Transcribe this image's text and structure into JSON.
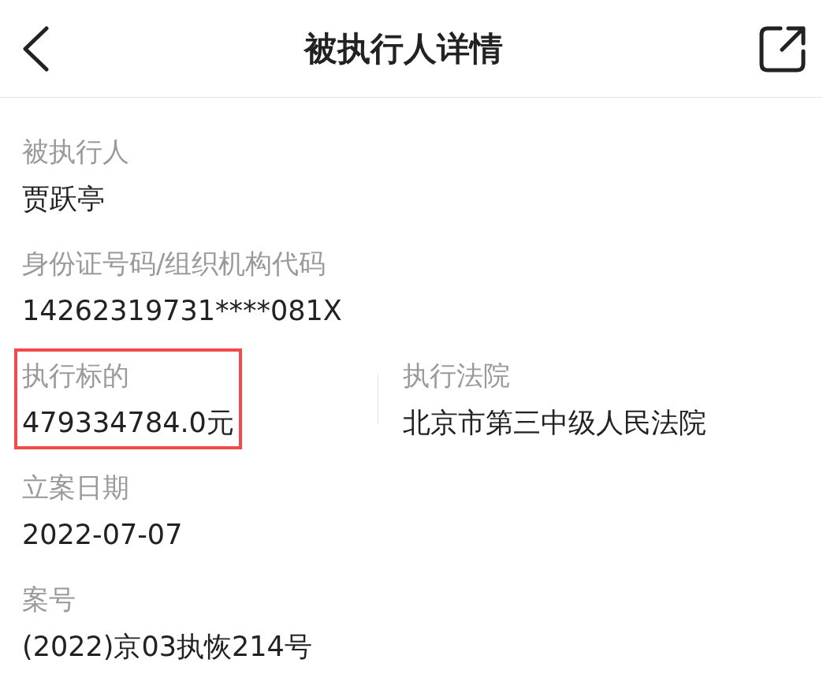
{
  "header": {
    "title": "被执行人详情"
  },
  "rows": [
    {
      "fields": [
        {
          "label": "被执行人",
          "value": "贾跃亭",
          "highlighted": false
        }
      ]
    },
    {
      "fields": [
        {
          "label": "身份证号码/组织机构代码",
          "value": "14262319731****081X",
          "highlighted": false
        }
      ]
    },
    {
      "fields": [
        {
          "label": "执行标的",
          "value": "479334784.0元",
          "highlighted": true
        },
        {
          "label": "执行法院",
          "value": "北京市第三中级人民法院",
          "highlighted": false
        }
      ]
    },
    {
      "fields": [
        {
          "label": "立案日期",
          "value": "2022-07-07",
          "highlighted": false
        }
      ]
    },
    {
      "fields": [
        {
          "label": "案号",
          "value": "(2022)京03执恢214号",
          "highlighted": false
        }
      ]
    }
  ]
}
